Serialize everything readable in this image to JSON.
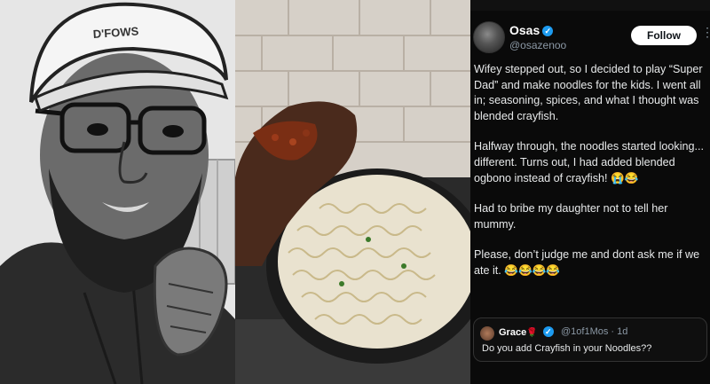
{
  "tweet": {
    "name": "Osas",
    "handle": "@osazenoo",
    "follow_label": "Follow",
    "more": "⋮",
    "paragraphs": [
      "Wifey stepped out, so I decided to play “Super Dad” and make noodles for the kids. I went all in; seasoning, spices, and what I thought was blended crayfish.",
      "Halfway through, the noodles started looking... different. Turns out, I had added blended ogbono instead of crayfish! 😭😂",
      "Had to bribe my daughter not to tell her mummy.",
      "Please, don’t judge me and dont ask me if we ate it. 😂😂😂😂"
    ]
  },
  "reply": {
    "name": "Grace",
    "rose": "🌹",
    "handle": "@1of1Mos · 1d",
    "text": "Do you add Crayfish in your Noodles??"
  },
  "left_panel": {
    "cap_text": "D'FOWS"
  },
  "colors": {
    "bg": "#0a0a0a",
    "verified": "#1d9bf0",
    "follow_bg": "#ffffff"
  }
}
